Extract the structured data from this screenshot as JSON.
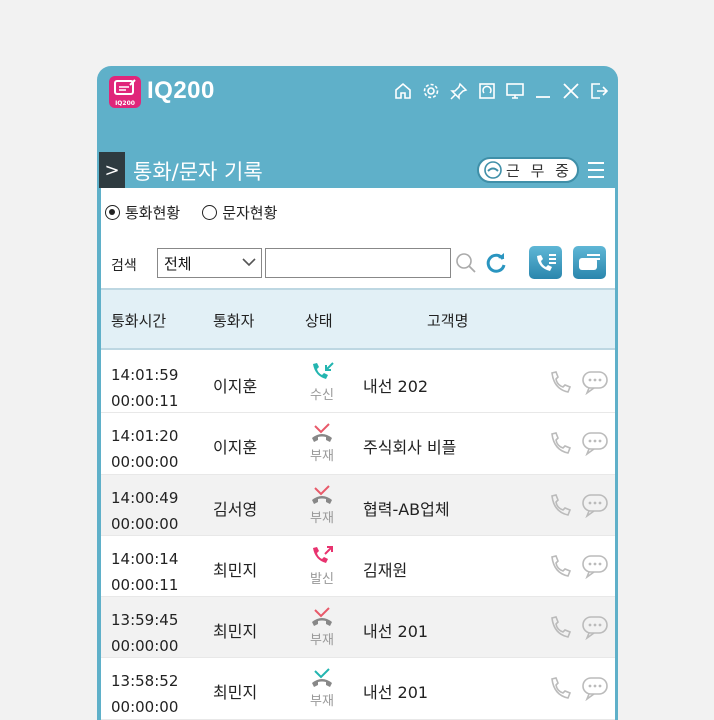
{
  "app": {
    "title": "IQ200",
    "logo_text": "IQ200"
  },
  "window_controls": [
    "home-icon",
    "gear-icon",
    "pin-icon",
    "sync-window-icon",
    "monitor-icon",
    "minimize-icon",
    "close-icon",
    "logout-icon"
  ],
  "header": {
    "expander": ">",
    "section_title": "통화/문자 기록",
    "work_status": "근 무 중"
  },
  "view_options": [
    {
      "label": "통화현황",
      "checked": true
    },
    {
      "label": "문자현황",
      "checked": false
    }
  ],
  "search": {
    "label": "검색",
    "filter_value": "전체",
    "query": ""
  },
  "table": {
    "columns": [
      "통화시간",
      "통화자",
      "상태",
      "고객명"
    ],
    "rows": [
      {
        "time": "14:01:59",
        "duration": "00:00:11",
        "caller": "이지훈",
        "status": "수신",
        "status_color": "#23b5b0",
        "customer": "내선 202"
      },
      {
        "time": "14:01:20",
        "duration": "00:00:00",
        "caller": "이지훈",
        "status": "부재",
        "status_color": "#e85a6a",
        "customer": "주식회사 비플"
      },
      {
        "time": "14:00:49",
        "duration": "00:00:00",
        "caller": "김서영",
        "status": "부재",
        "status_color": "#e85a6a",
        "customer": "협력-AB업체"
      },
      {
        "time": "14:00:14",
        "duration": "00:00:11",
        "caller": "최민지",
        "status": "발신",
        "status_color": "#e8336f",
        "customer": "김재원"
      },
      {
        "time": "13:59:45",
        "duration": "00:00:00",
        "caller": "최민지",
        "status": "부재",
        "status_color": "#e85a6a",
        "customer": "내선 201"
      },
      {
        "time": "13:58:52",
        "duration": "00:00:00",
        "caller": "최민지",
        "status": "부재",
        "status_color": "#23b5b0",
        "customer": "내선 201"
      }
    ]
  },
  "colors": {
    "titlebar": "#5fb0c9",
    "logo": "#e0267a",
    "header_row": "#e2f0f6"
  }
}
